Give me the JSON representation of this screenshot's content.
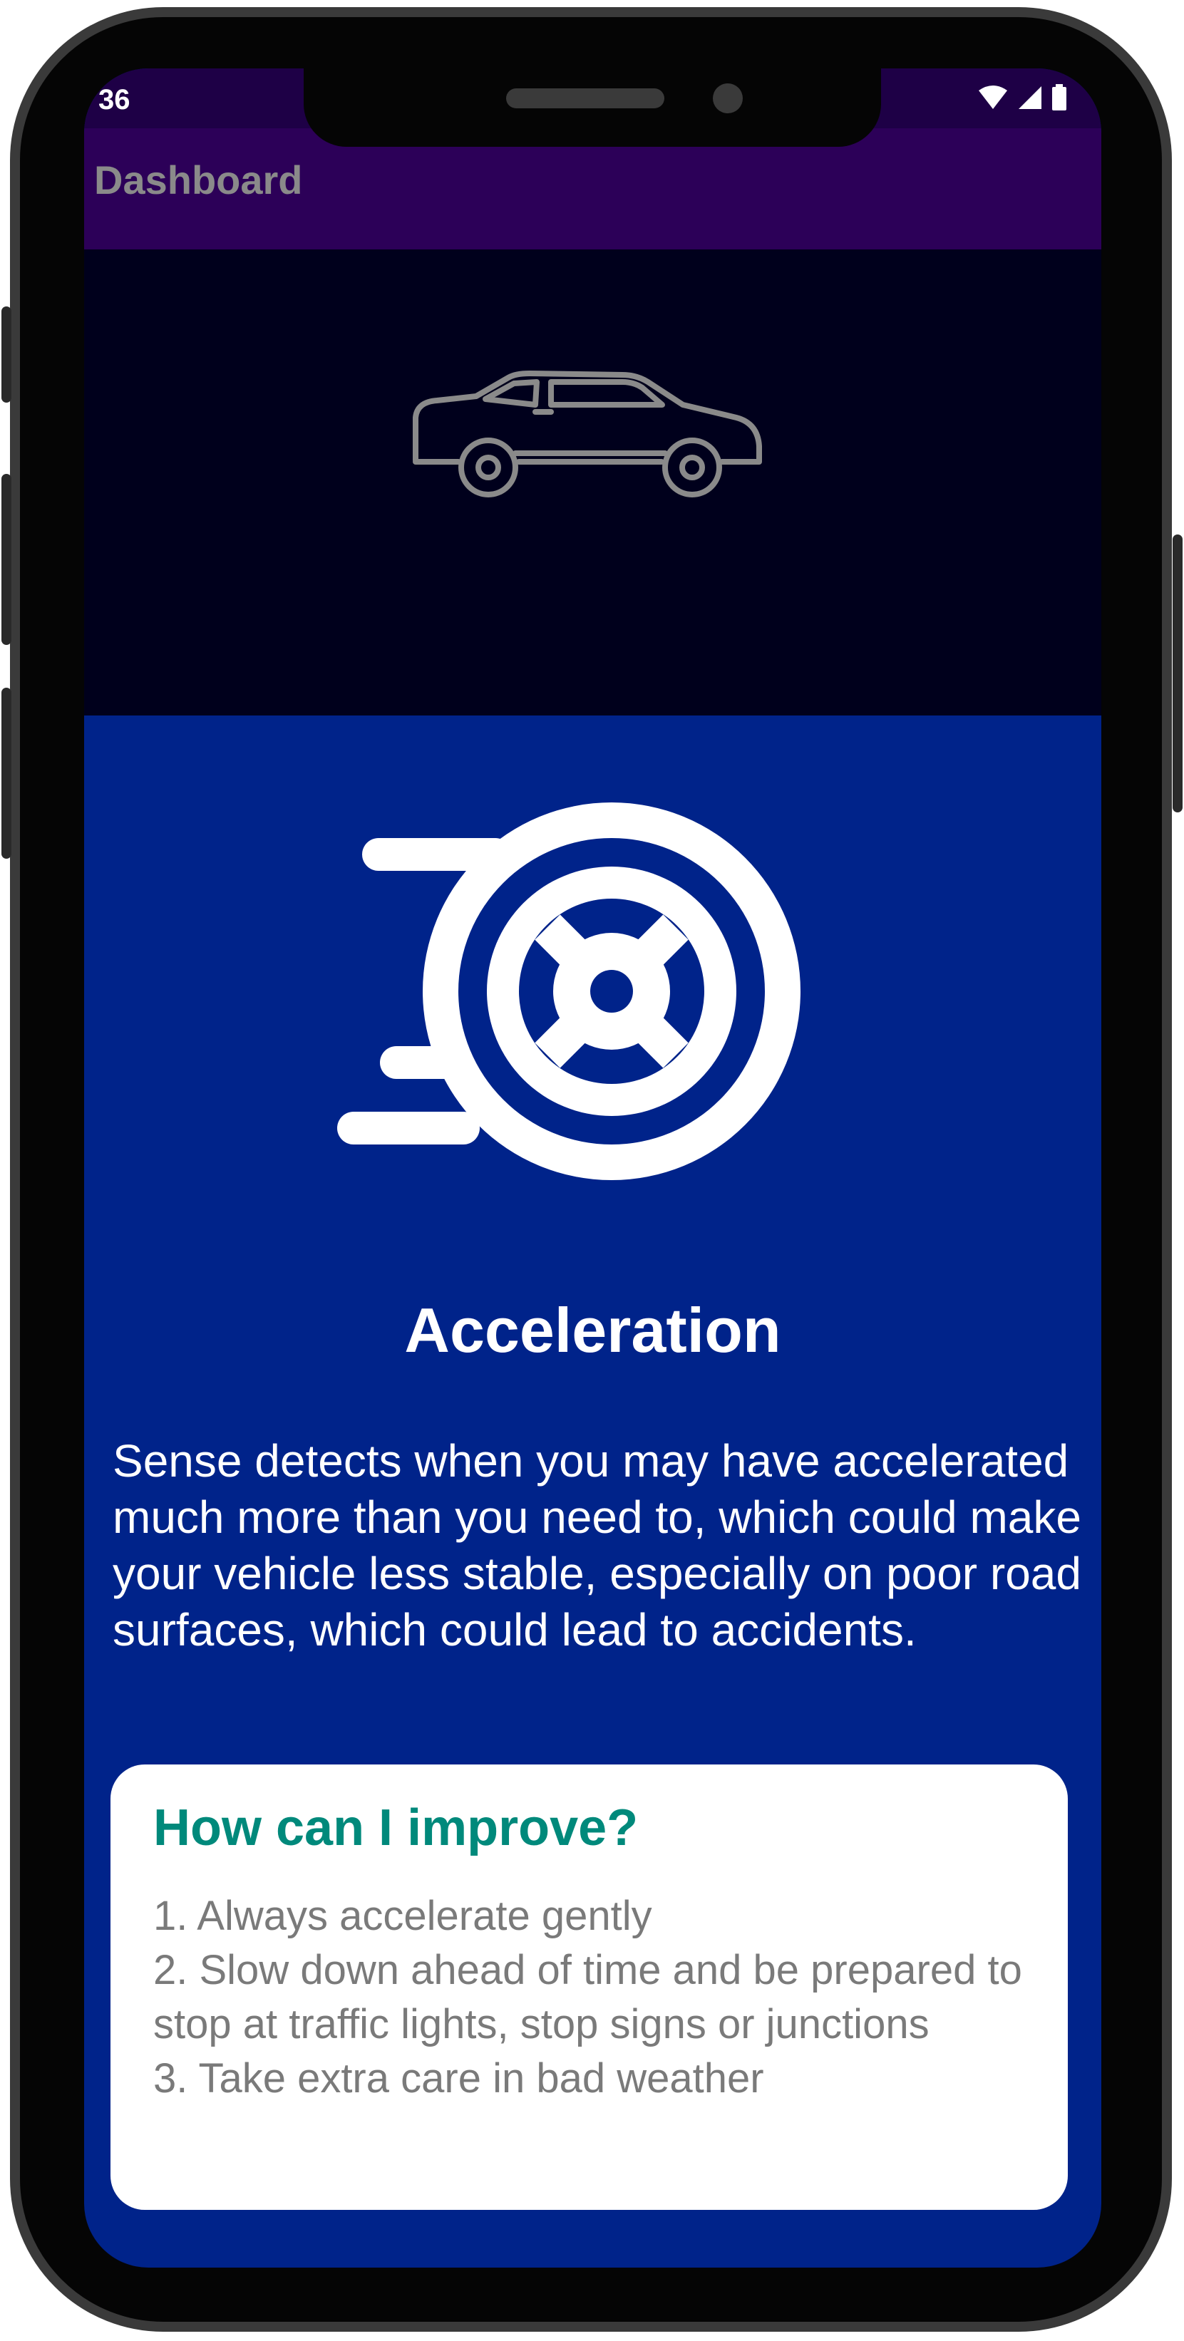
{
  "status_bar": {
    "time": "36",
    "icons": [
      "wifi-icon",
      "signal-icon",
      "battery-icon"
    ]
  },
  "app_bar": {
    "title": "Dashboard"
  },
  "hero": {
    "icon": "car-icon"
  },
  "section": {
    "icon": "accelerating-wheel-icon",
    "title": "Acceleration",
    "description": "Sense detects when you may have accelerated much more than you need to, which could make your vehicle less stable, especially on poor road surfaces, which could lead to accidents."
  },
  "tips_card": {
    "title": "How can I improve?",
    "items": [
      "1. Always accelerate gently",
      "2. Slow down ahead of time and be prepared to stop at traffic lights, stop signs or junctions",
      "3. Take extra care in bad weather"
    ]
  },
  "colors": {
    "status_bar": "#1e0046",
    "app_bar": "#2c0058",
    "hero_bg": "#00001c",
    "content_bg": "#00238a",
    "card_title": "#00897b",
    "card_text": "#7a7a7a"
  }
}
